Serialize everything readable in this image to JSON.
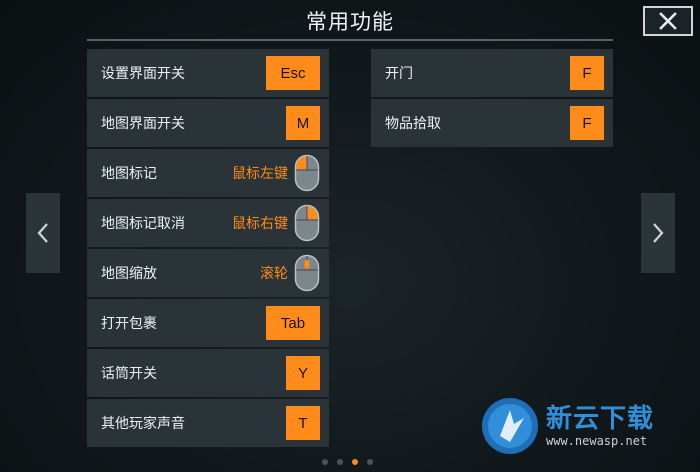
{
  "header": {
    "title": "常用功能"
  },
  "left_column": [
    {
      "label": "设置界面开关",
      "kind": "key",
      "key": "Esc"
    },
    {
      "label": "地图界面开关",
      "kind": "key",
      "key": "M"
    },
    {
      "label": "地图标记",
      "kind": "mouse",
      "mouse_text": "鼠标左键",
      "icon": "mouse-left-icon"
    },
    {
      "label": "地图标记取消",
      "kind": "mouse",
      "mouse_text": "鼠标右键",
      "icon": "mouse-right-icon"
    },
    {
      "label": "地图缩放",
      "kind": "mouse",
      "mouse_text": "滚轮",
      "icon": "mouse-wheel-icon"
    },
    {
      "label": "打开包裹",
      "kind": "key",
      "key": "Tab"
    },
    {
      "label": "话筒开关",
      "kind": "key",
      "key": "Y"
    },
    {
      "label": "其他玩家声音",
      "kind": "key",
      "key": "T"
    }
  ],
  "right_column": [
    {
      "label": "开门",
      "kind": "key",
      "key": "F"
    },
    {
      "label": "物品拾取",
      "kind": "key",
      "key": "F"
    }
  ],
  "pagination": {
    "count": 4,
    "active_index": 2
  },
  "watermark": {
    "title": "新云下载",
    "url": "www.newasp.net"
  },
  "colors": {
    "accent": "#ff8c1a",
    "row_bg": "#2a3337",
    "background": "#11181b"
  }
}
